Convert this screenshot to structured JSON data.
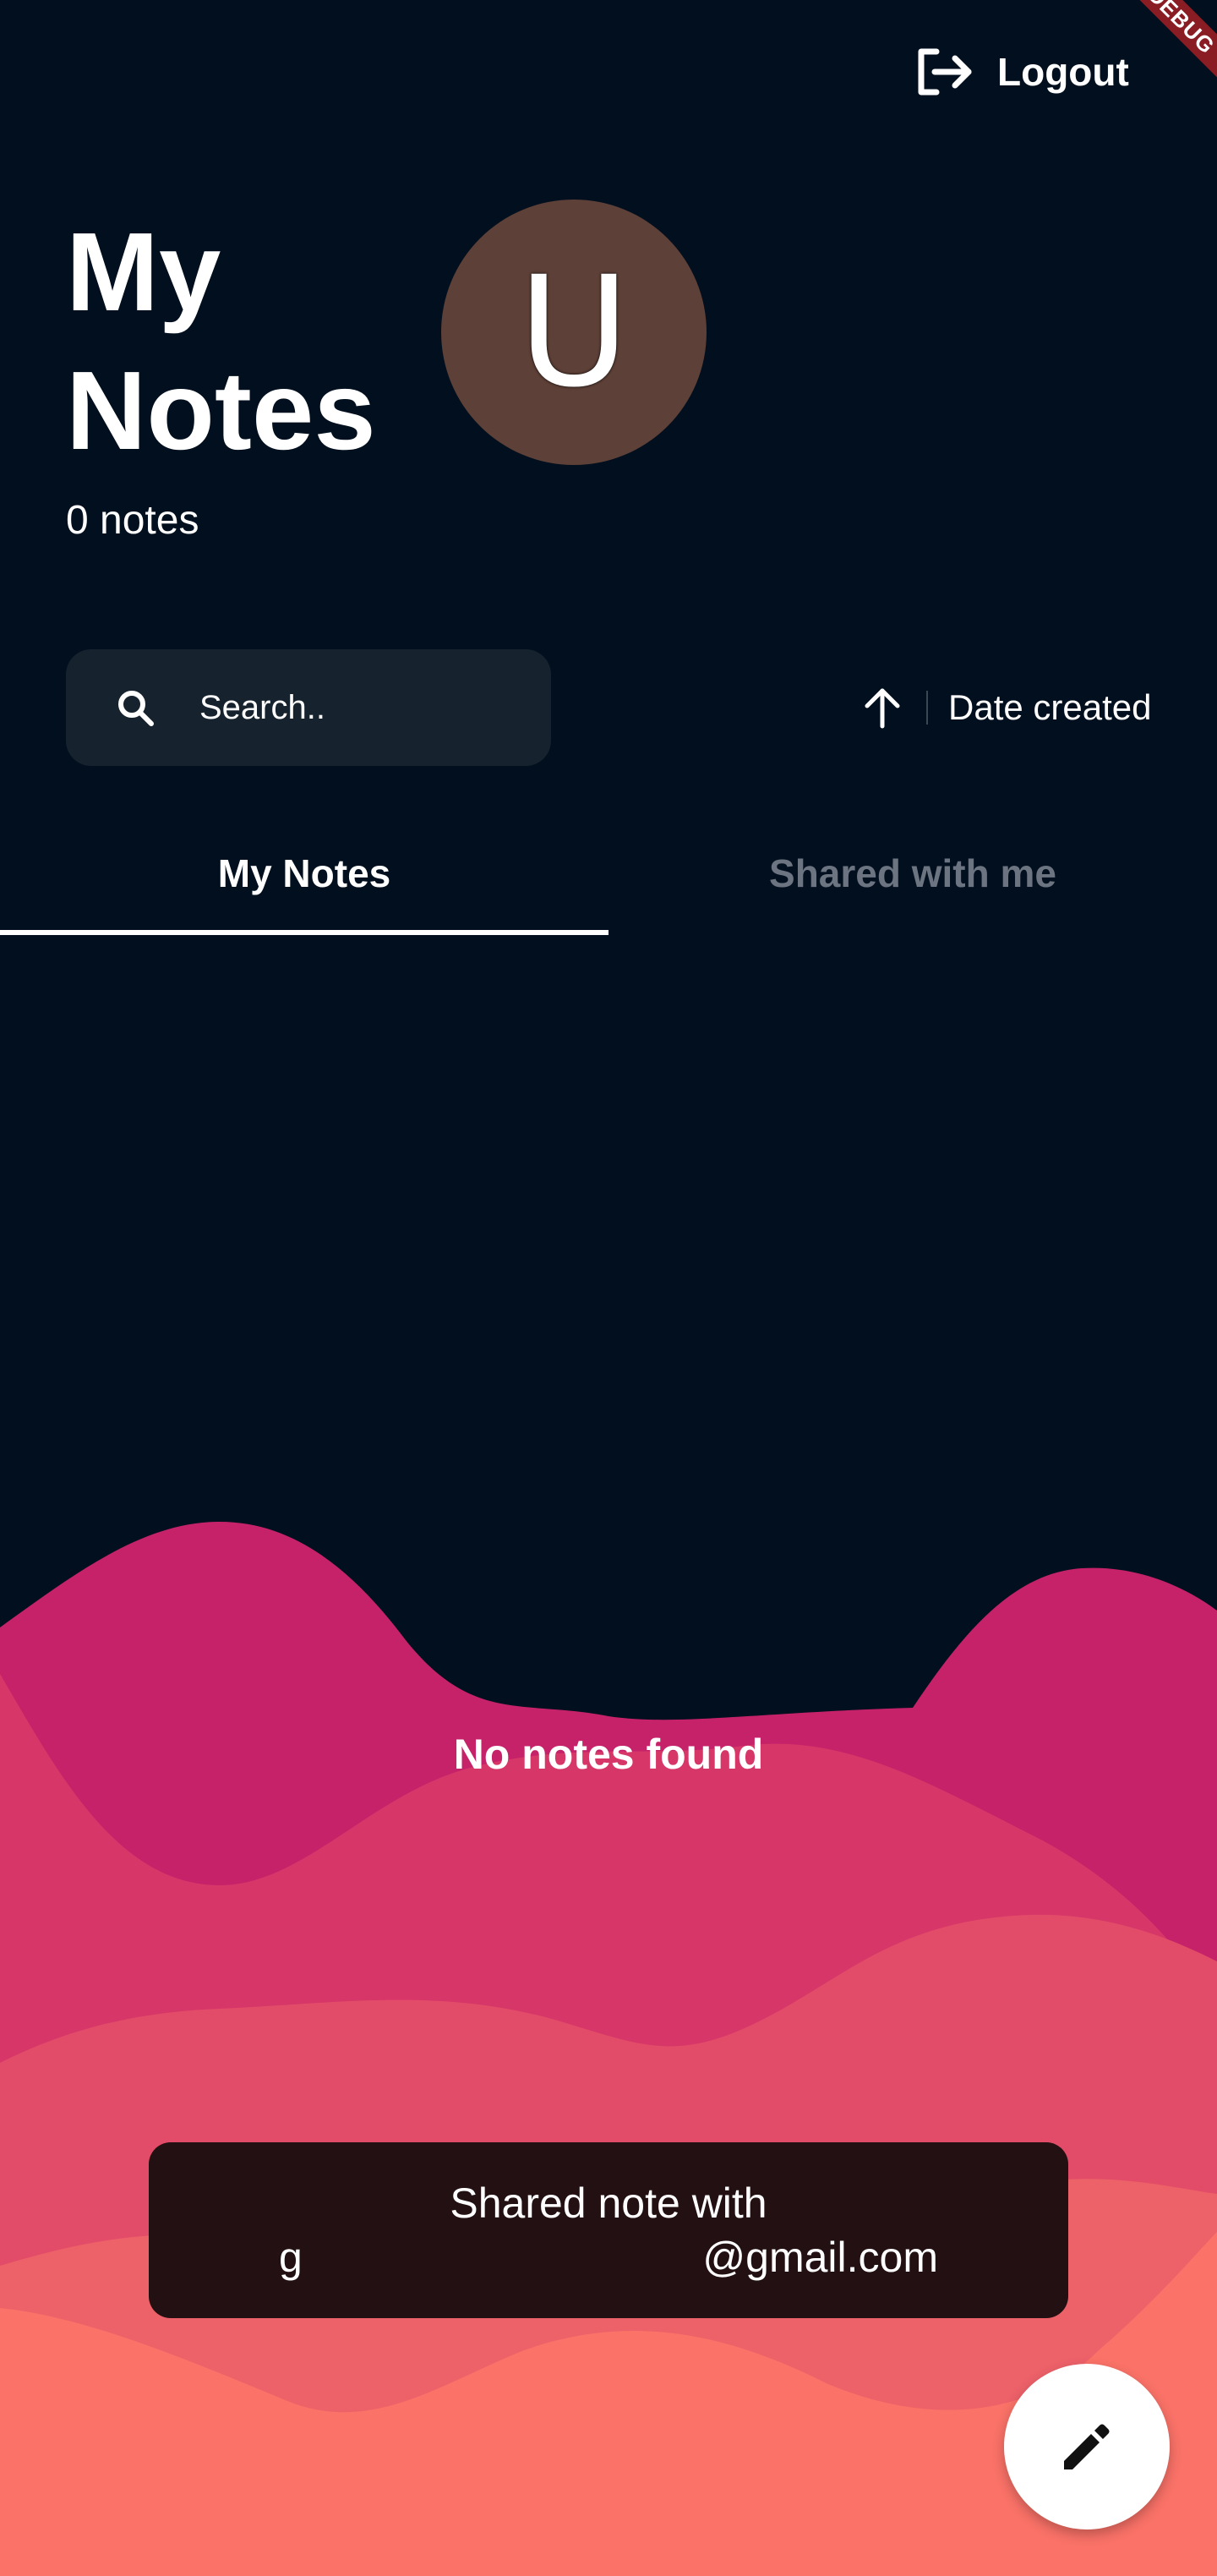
{
  "debug_banner": "DEBUG",
  "header": {
    "logout_label": "Logout"
  },
  "title": {
    "line1": "My",
    "line2": "Notes"
  },
  "notes_count": "0 notes",
  "avatar": {
    "initial": "U",
    "color": "#5d4037"
  },
  "search": {
    "placeholder": "Search.."
  },
  "sort": {
    "direction_icon": "arrow-up-icon",
    "label": "Date created"
  },
  "tabs": [
    {
      "label": "My Notes",
      "active": true
    },
    {
      "label": "Shared with me",
      "active": false
    }
  ],
  "empty_state": "No notes found",
  "snackbar": {
    "line1": "Shared note with",
    "line2_start": "g",
    "line2_end": "@gmail.com"
  },
  "fab": {
    "icon": "pencil-icon"
  },
  "colors": {
    "background": "#020f1e",
    "search_bg": "#16232f",
    "wave_colors": [
      "#c5226a",
      "#d73768",
      "#e24c68",
      "#ed6169",
      "#fa7268"
    ],
    "snackbar_bg": "#231012"
  }
}
